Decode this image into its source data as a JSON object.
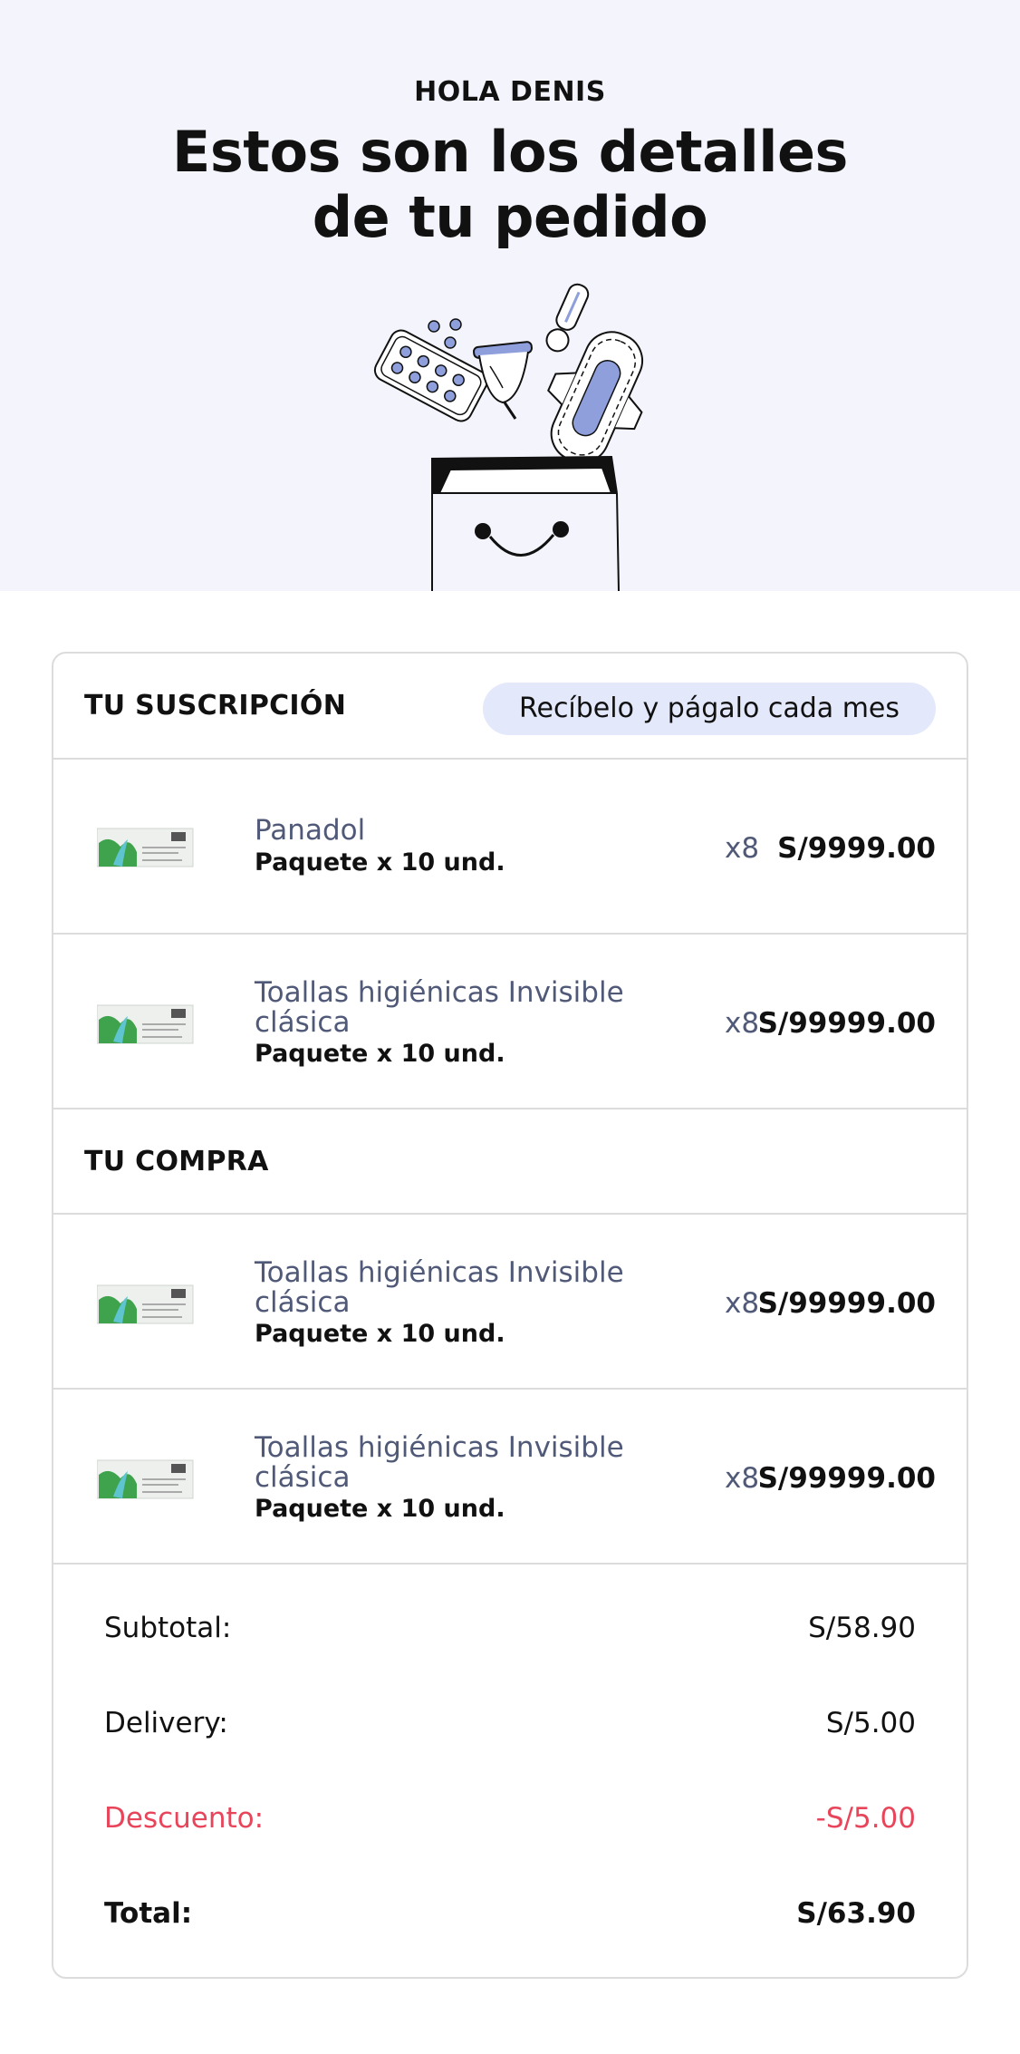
{
  "header": {
    "greeting": "HOLA DENIS",
    "headline_line1": "Estos son los detalles",
    "headline_line2": "de tu pedido",
    "illustration": "shopping-bag-with-menstrual-products-illustration"
  },
  "subscription": {
    "title": "TU SUSCRIPCIÓN",
    "badge": "Recíbelo y págalo cada mes",
    "items": [
      {
        "name": "Panadol",
        "name_line2": "",
        "pack": "Paquete x 10 und.",
        "qty": "x8",
        "price": "S/9999.00",
        "thumb": "product-box-image"
      },
      {
        "name": "Toallas higiénicas Invisible",
        "name_line2": "clásica",
        "pack": "Paquete x 10 und.",
        "qty": "x8",
        "price": "S/99999.00",
        "thumb": "product-box-image"
      }
    ]
  },
  "purchase": {
    "title": "TU COMPRA",
    "items": [
      {
        "name": "Toallas higiénicas Invisible",
        "name_line2": "clásica",
        "pack": "Paquete x 10 und.",
        "qty": "x8",
        "price": "S/99999.00",
        "thumb": "product-box-image"
      },
      {
        "name": "Toallas higiénicas Invisible",
        "name_line2": "clásica",
        "pack": "Paquete x 10 und.",
        "qty": "x8",
        "price": "S/99999.00",
        "thumb": "product-box-image"
      }
    ]
  },
  "summary": {
    "subtotal_label": "Subtotal:",
    "subtotal_value": "S/58.90",
    "delivery_label": "Delivery:",
    "delivery_value": "S/5.00",
    "discount_label": "Descuento:",
    "discount_value": "-S/5.00",
    "total_label": "Total:",
    "total_value": "S/63.90"
  },
  "colors": {
    "hero_bg": "#f4f5fc",
    "pill_bg": "#e3e8fb",
    "product_name": "#505a78",
    "discount": "#e8445a",
    "accent_purple": "#8e9fdc"
  }
}
